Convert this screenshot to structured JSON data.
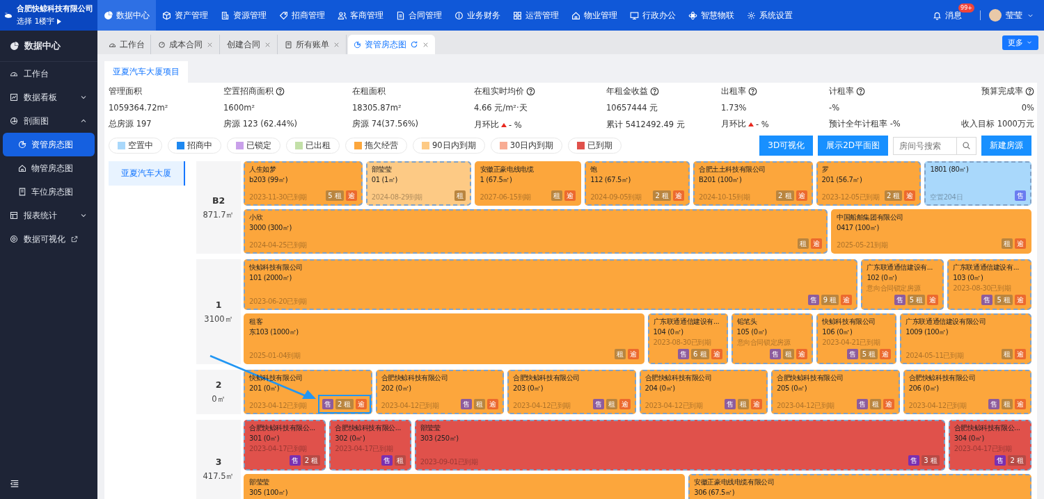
{
  "brand": {
    "company": "合肥快鲸科技有限公司",
    "selector": "选择 1楼宇"
  },
  "nav": [
    {
      "label": "数据中心",
      "selected": true
    },
    {
      "label": "资产管理",
      "selected": false
    },
    {
      "label": "资源管理",
      "selected": false
    },
    {
      "label": "招商管理",
      "selected": false
    },
    {
      "label": "客商管理",
      "selected": false
    },
    {
      "label": "合同管理",
      "selected": false
    },
    {
      "label": "业务财务",
      "selected": false
    },
    {
      "label": "运营管理",
      "selected": false
    },
    {
      "label": "物业管理",
      "selected": false
    },
    {
      "label": "行政办公",
      "selected": false
    },
    {
      "label": "智慧物联",
      "selected": false
    },
    {
      "label": "系统设置",
      "selected": false
    }
  ],
  "user": {
    "notice_label": "消息",
    "notice_count": "99+",
    "name": "莹莹"
  },
  "sidebar": {
    "title": "数据中心",
    "items": [
      {
        "label": "工作台",
        "kind": "link",
        "selected": false
      },
      {
        "label": "数据看板",
        "kind": "group",
        "expanded": false,
        "selected": false
      },
      {
        "label": "剖面图",
        "kind": "group",
        "expanded": true,
        "selected": false,
        "children": [
          {
            "label": "资管房态图",
            "selected": true
          },
          {
            "label": "物管房态图",
            "selected": false
          },
          {
            "label": "车位房态图",
            "selected": false
          }
        ]
      },
      {
        "label": "报表统计",
        "kind": "group",
        "expanded": false,
        "selected": false
      },
      {
        "label": "数据可视化",
        "kind": "external",
        "selected": false
      }
    ]
  },
  "tabs": [
    {
      "label": "工作台",
      "selected": false,
      "closable": false
    },
    {
      "label": "成本合同",
      "selected": false,
      "closable": true
    },
    {
      "label": "创建合同",
      "selected": false,
      "closable": true
    },
    {
      "label": "所有账单",
      "selected": false,
      "closable": true
    },
    {
      "label": "资管房态图",
      "selected": true,
      "closable": true
    }
  ],
  "more_button": "更多",
  "project_tabs": [
    {
      "label": "亚夏汽车大厦项目",
      "selected": true
    }
  ],
  "stats": [
    {
      "label": "管理面积",
      "help": false,
      "value": "1059364.72m²",
      "sub": "总房源 197"
    },
    {
      "label": "空置招商面积",
      "help": true,
      "value": "1600m²",
      "sub": "房源 123 (62.44%)"
    },
    {
      "label": "在租面积",
      "help": false,
      "value": "18305.87m²",
      "sub": "房源 74(37.56%)"
    },
    {
      "label": "在租实时均价",
      "help": true,
      "value": "4.66 元/m²·天",
      "sub": "月环比",
      "change": "- %"
    },
    {
      "label": "年租金收益",
      "help": true,
      "value": "10657444 元",
      "sub": "累计 5412492.49 元"
    },
    {
      "label": "出租率",
      "help": true,
      "value": "1.73%",
      "sub": "月环比",
      "change": "- %"
    },
    {
      "label": "计租率",
      "help": true,
      "value": "-%",
      "sub": "预计全年计租率 -%"
    },
    {
      "label": "预算完成率",
      "help": true,
      "value": "0%",
      "sub": "收入目标 1000万元"
    }
  ],
  "legend": [
    {
      "label": "空置中",
      "color": "#a9d8fb"
    },
    {
      "label": "招商中",
      "color": "#1e88f0"
    },
    {
      "label": "已锁定",
      "color": "#c9a0ea"
    },
    {
      "label": "已出租",
      "color": "#c3e0a8"
    },
    {
      "label": "拖欠经营",
      "color": "#fca63c"
    },
    {
      "label": "90日内到期",
      "color": "#fdca85"
    },
    {
      "label": "30日内到期",
      "color": "#f8ac94"
    },
    {
      "label": "已到期",
      "color": "#e0514b"
    }
  ],
  "toolbar": {
    "buttons": [
      "3D可视化",
      "展示2D平面图"
    ],
    "search_placeholder": "房间号搜索",
    "create_button": "新建房源"
  },
  "buildings": [
    {
      "label": "亚夏汽车大厦",
      "selected": true
    }
  ],
  "floors": [
    {
      "name": "B2",
      "area": "871.7㎡",
      "bands": [
        {
          "rooms": [
            {
              "tenant": "人生如梦",
              "unit": "b203 (99㎡)",
              "note": "2023-11-30已到期",
              "color": "#fca63c",
              "dashed": true,
              "tags": [
                {
                  "kind": "rent",
                  "text": "5 租"
                },
                {
                  "kind": "overdue",
                  "text": "逾"
                }
              ]
            },
            {
              "tenant": "部莹莹",
              "unit": "01 (1㎡)",
              "note": "2024-08-29到期",
              "color": "#fdca85",
              "dashed": true,
              "tags": [
                {
                  "kind": "rent",
                  "text": "租"
                }
              ]
            },
            {
              "tenant": "安徽正豪电线电缆",
              "unit": "1 (67.5㎡)",
              "note": "2027-06-15到期",
              "color": "#fca63c",
              "dashed": false,
              "tags": [
                {
                  "kind": "rent",
                  "text": "租"
                },
                {
                  "kind": "overdue",
                  "text": "逾"
                }
              ]
            },
            {
              "tenant": "饱",
              "unit": "112 (67.5㎡)",
              "note": "2024-09-05到期",
              "color": "#fca63c",
              "dashed": true,
              "tags": [
                {
                  "kind": "rent",
                  "text": "2 租"
                },
                {
                  "kind": "overdue",
                  "text": "逾"
                }
              ]
            },
            {
              "tenant": "合肥土土科技有限公司",
              "unit": "B201 (100㎡)",
              "note": "2024-10-15到期",
              "color": "#fca63c",
              "dashed": true,
              "tags": [
                {
                  "kind": "rent",
                  "text": "2 租"
                },
                {
                  "kind": "overdue",
                  "text": "逾"
                }
              ]
            },
            {
              "tenant": "罗",
              "unit": "201 (56.7㎡)",
              "note": "2023-12-05已到期",
              "color": "#fca63c",
              "dashed": true,
              "tags": [
                {
                  "kind": "rent",
                  "text": "2 租"
                },
                {
                  "kind": "overdue",
                  "text": "逾"
                }
              ]
            },
            {
              "unit": "1801 (80㎡)",
              "note": "空置204日",
              "color": "#a9d8fb",
              "dashed": true,
              "tags": [
                {
                  "kind": "sale-vacant",
                  "text": "售"
                }
              ]
            }
          ]
        },
        {
          "rooms": [
            {
              "tenant": "小欣",
              "unit": "3000 (300㎡)",
              "note": "2024-04-25已到期",
              "color": "#fca63c",
              "dashed": true,
              "tags": [
                {
                  "kind": "rent",
                  "text": "租"
                },
                {
                  "kind": "overdue",
                  "text": "逾"
                }
              ]
            },
            {
              "tenant": "中国船舶集团有限公司",
              "unit": "0417 (100㎡)",
              "note": "2025-05-21到期",
              "color": "#fca63c",
              "dashed": false,
              "tags": [
                {
                  "kind": "rent",
                  "text": "租"
                },
                {
                  "kind": "overdue",
                  "text": "逾"
                }
              ]
            }
          ]
        }
      ]
    },
    {
      "name": "1",
      "area": "3100㎡",
      "bands": [
        {
          "rooms": [
            {
              "tenant": "快鲸科技有限公司",
              "unit": "101 (2000㎡)",
              "note": "2023-06-20已到期",
              "color": "#fca63c",
              "dashed": true,
              "tags": [
                {
                  "kind": "sale",
                  "text": "售"
                },
                {
                  "kind": "rent",
                  "text": "9 租"
                },
                {
                  "kind": "overdue",
                  "text": "逾"
                }
              ]
            },
            {
              "tenant": "广东联通通信建设有...",
              "unit": "102 (0㎡)",
              "note": "意向合同锁定房源",
              "color": "#fca63c",
              "dashed": true,
              "tags": [
                {
                  "kind": "sale",
                  "text": "售"
                },
                {
                  "kind": "rent",
                  "text": "5 租"
                },
                {
                  "kind": "overdue",
                  "text": "逾"
                }
              ]
            },
            {
              "tenant": "广东联通通信建设有...",
              "unit": "103 (0㎡)",
              "note": "2023-08-30已到期",
              "color": "#fca63c",
              "dashed": true,
              "tags": [
                {
                  "kind": "sale",
                  "text": "售"
                },
                {
                  "kind": "rent",
                  "text": "5 租"
                },
                {
                  "kind": "overdue",
                  "text": "逾"
                }
              ]
            }
          ]
        },
        {
          "rooms": [
            {
              "tenant": "租客",
              "unit": "东103 (1000㎡)",
              "note": "2025-01-04到期",
              "color": "#fca63c",
              "dashed": false,
              "tags": [
                {
                  "kind": "rent",
                  "text": "租"
                },
                {
                  "kind": "overdue",
                  "text": "逾"
                }
              ]
            },
            {
              "tenant": "广东联通通信建设有...",
              "unit": "104 (0㎡)",
              "note": "2023-08-30已到期",
              "color": "#fca63c",
              "dashed": true,
              "tags": [
                {
                  "kind": "sale",
                  "text": "售"
                },
                {
                  "kind": "rent",
                  "text": "6 租"
                },
                {
                  "kind": "overdue",
                  "text": "逾"
                }
              ]
            },
            {
              "tenant": "铅笔头",
              "unit": "105 (0㎡)",
              "note": "意向合同锁定房源",
              "color": "#fca63c",
              "dashed": true,
              "tags": [
                {
                  "kind": "sale",
                  "text": "售"
                },
                {
                  "kind": "rent",
                  "text": "租"
                },
                {
                  "kind": "overdue",
                  "text": "逾"
                }
              ]
            },
            {
              "tenant": "快鲸科技有限公司",
              "unit": "106 (0㎡)",
              "note": "2023-04-21已到期",
              "color": "#fca63c",
              "dashed": true,
              "tags": [
                {
                  "kind": "sale",
                  "text": "售"
                },
                {
                  "kind": "rent",
                  "text": "5 租"
                },
                {
                  "kind": "overdue",
                  "text": "逾"
                }
              ]
            },
            {
              "tenant": "广东联通通信建设有限公司",
              "unit": "1009 (100㎡)",
              "note": "2024-05-11已到期",
              "color": "#fca63c",
              "dashed": true,
              "tags": [
                {
                  "kind": "rent",
                  "text": "租"
                },
                {
                  "kind": "overdue",
                  "text": "逾"
                }
              ]
            }
          ]
        }
      ]
    },
    {
      "name": "2",
      "area": "0㎡",
      "bands": [
        {
          "rooms": [
            {
              "tenant": "快鲸科技有限公司",
              "unit": "201 (0㎡)",
              "note": "2023-04-12已到期",
              "color": "#fca63c",
              "dashed": true,
              "highlighted": true,
              "tags": [
                {
                  "kind": "sale",
                  "text": "售"
                },
                {
                  "kind": "rent",
                  "text": "2 租"
                },
                {
                  "kind": "overdue",
                  "text": "逾"
                }
              ]
            },
            {
              "tenant": "合肥快鲸科技有限公司",
              "unit": "202 (0㎡)",
              "note": "2023-04-12已到期",
              "color": "#fca63c",
              "dashed": true,
              "tags": [
                {
                  "kind": "sale",
                  "text": "售"
                },
                {
                  "kind": "rent",
                  "text": "租"
                },
                {
                  "kind": "overdue",
                  "text": "逾"
                }
              ]
            },
            {
              "tenant": "合肥快鲸科技有限公司",
              "unit": "203 (0㎡)",
              "note": "2023-04-12已到期",
              "color": "#fca63c",
              "dashed": true,
              "tags": [
                {
                  "kind": "sale",
                  "text": "售"
                },
                {
                  "kind": "rent",
                  "text": "租"
                },
                {
                  "kind": "overdue",
                  "text": "逾"
                }
              ]
            },
            {
              "tenant": "合肥快鲸科技有限公司",
              "unit": "204 (0㎡)",
              "note": "2023-04-12已到期",
              "color": "#fca63c",
              "dashed": true,
              "tags": [
                {
                  "kind": "sale",
                  "text": "售"
                },
                {
                  "kind": "rent",
                  "text": "租"
                },
                {
                  "kind": "overdue",
                  "text": "逾"
                }
              ]
            },
            {
              "tenant": "合肥快鲸科技有限公司",
              "unit": "205 (0㎡)",
              "note": "2023-04-12已到期",
              "color": "#fca63c",
              "dashed": true,
              "tags": [
                {
                  "kind": "sale",
                  "text": "售"
                },
                {
                  "kind": "rent",
                  "text": "租"
                },
                {
                  "kind": "overdue",
                  "text": "逾"
                }
              ]
            },
            {
              "tenant": "合肥快鲸科技有限公司",
              "unit": "206 (0㎡)",
              "note": "2023-04-12已到期",
              "color": "#fca63c",
              "dashed": true,
              "tags": [
                {
                  "kind": "sale",
                  "text": "售"
                },
                {
                  "kind": "rent",
                  "text": "租"
                },
                {
                  "kind": "overdue",
                  "text": "逾"
                }
              ]
            }
          ]
        }
      ]
    },
    {
      "name": "3",
      "area": "417.5㎡",
      "bands": [
        {
          "rooms": [
            {
              "tenant": "合肥快鲸科技有限公...",
              "unit": "301 (0㎡)",
              "note": "2023-04-17已到期",
              "color": "#e0514b",
              "dashed": true,
              "tags": [
                {
                  "kind": "sale",
                  "text": "售"
                },
                {
                  "kind": "rent",
                  "text": "2 租"
                }
              ]
            },
            {
              "tenant": "合肥快鲸科技有限公...",
              "unit": "302 (0㎡)",
              "note": "2023-04-17已到期",
              "color": "#e0514b",
              "dashed": true,
              "tags": [
                {
                  "kind": "sale",
                  "text": "售"
                },
                {
                  "kind": "rent",
                  "text": "租"
                }
              ]
            },
            {
              "tenant": "部莹莹",
              "unit": "303 (250㎡)",
              "note": "2023-09-01已到期",
              "color": "#e0514b",
              "dashed": true,
              "tags": [
                {
                  "kind": "sale",
                  "text": "售"
                },
                {
                  "kind": "rent",
                  "text": "3 租"
                }
              ]
            },
            {
              "tenant": "合肥快鲸科技有限公...",
              "unit": "304 (0㎡)",
              "note": "2023-04-17已到期",
              "color": "#e0514b",
              "dashed": true,
              "tags": [
                {
                  "kind": "sale",
                  "text": "售"
                },
                {
                  "kind": "rent",
                  "text": "2 租"
                }
              ]
            }
          ]
        },
        {
          "rooms": [
            {
              "tenant": "部莹莹",
              "unit": "305 (100㎡)",
              "color": "#fca63c",
              "dashed": false
            },
            {
              "tenant": "安徽正豪电线电缆有限公司",
              "unit": "306 (67.5㎡)",
              "color": "#fca63c",
              "dashed": true
            }
          ]
        }
      ]
    }
  ]
}
